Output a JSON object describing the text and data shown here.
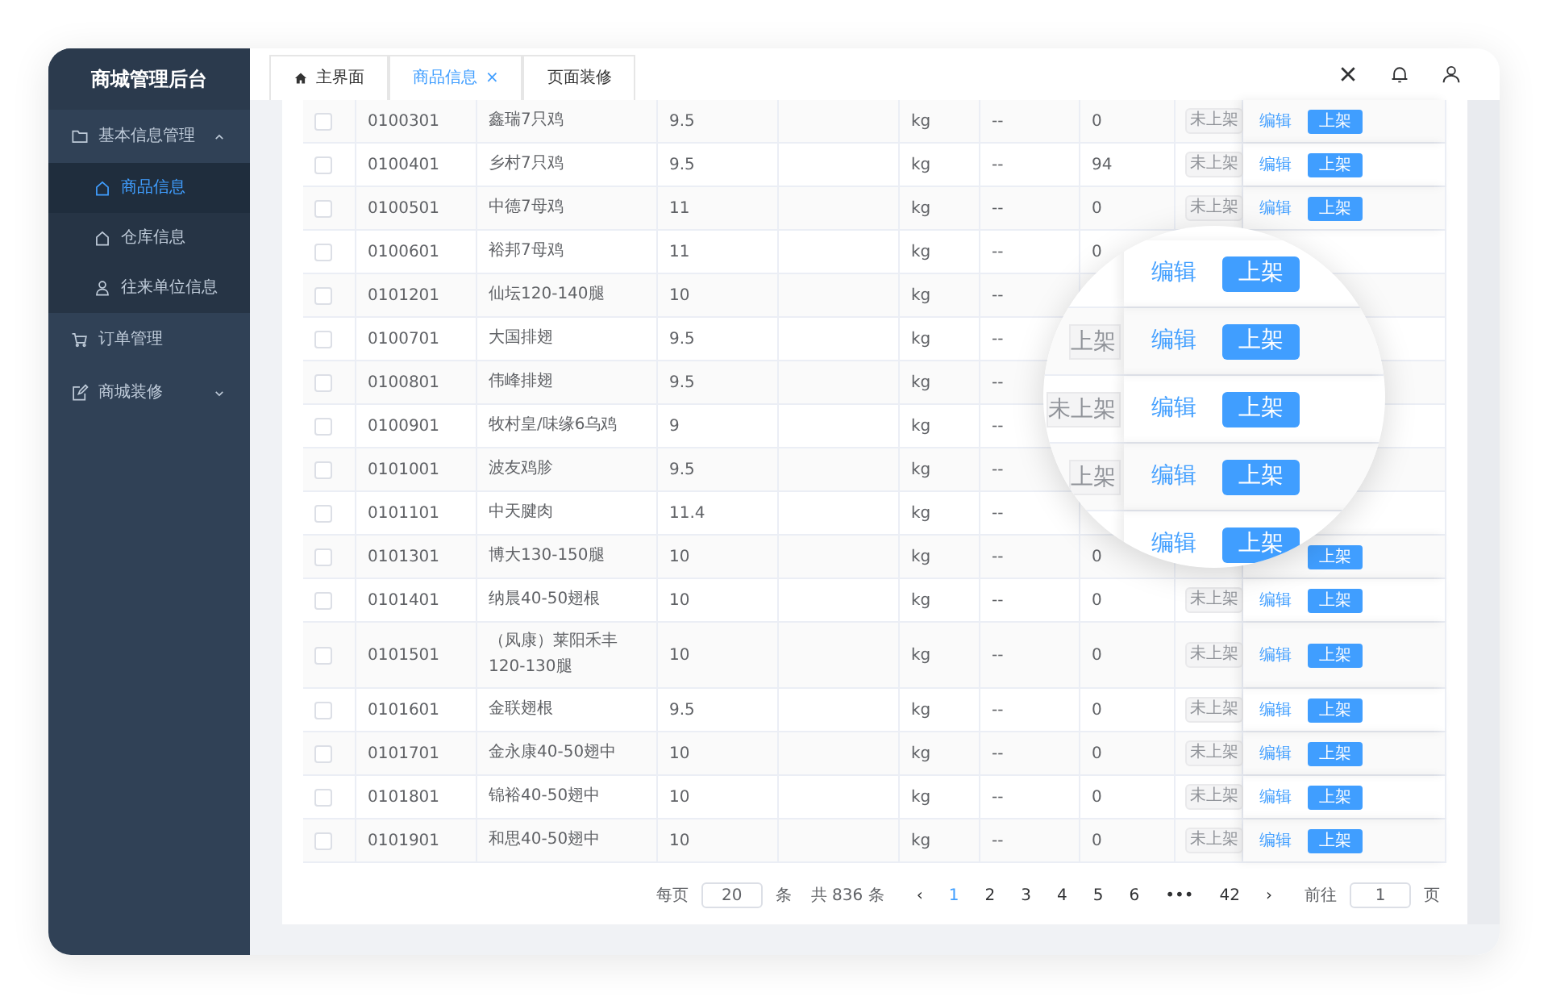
{
  "sidebar": {
    "title": "商城管理后台",
    "items": [
      {
        "label": "基本信息管理",
        "expanded": true,
        "children": [
          {
            "label": "商品信息",
            "selected": true
          },
          {
            "label": "仓库信息",
            "selected": false
          },
          {
            "label": "往来单位信息",
            "selected": false
          }
        ]
      },
      {
        "label": "订单管理"
      },
      {
        "label": "商城装修",
        "expanded": false
      }
    ]
  },
  "tabs": [
    {
      "label": "主界面",
      "selected": false
    },
    {
      "label": "商品信息",
      "selected": true,
      "close": "×"
    },
    {
      "label": "页面装修",
      "selected": false
    }
  ],
  "table": {
    "rows": [
      {
        "checked": false,
        "code": "0100301",
        "name": "鑫瑞7只鸡",
        "price": "9.5",
        "unit": "kg",
        "dash": "--",
        "qty": "0",
        "status": "未上架",
        "edit": "编辑",
        "publish": "上架"
      },
      {
        "checked": false,
        "code": "0100401",
        "name": "乡村7只鸡",
        "price": "9.5",
        "unit": "kg",
        "dash": "--",
        "qty": "94",
        "status": "未上架",
        "edit": "编辑",
        "publish": "上架"
      },
      {
        "checked": false,
        "code": "0100501",
        "name": "中德7母鸡",
        "price": "11",
        "unit": "kg",
        "dash": "--",
        "qty": "0",
        "status": "未上架",
        "edit": "编辑",
        "publish": "上架"
      },
      {
        "checked": false,
        "code": "0100601",
        "name": "裕邦7母鸡",
        "price": "11",
        "unit": "kg",
        "dash": "--",
        "qty": "0"
      },
      {
        "checked": false,
        "code": "0101201",
        "name": "仙坛120-140腿",
        "price": "10",
        "unit": "kg",
        "dash": "--"
      },
      {
        "checked": false,
        "code": "0100701",
        "name": "大国排翅",
        "price": "9.5",
        "unit": "kg",
        "dash": "--"
      },
      {
        "checked": false,
        "code": "0100801",
        "name": "伟峰排翅",
        "price": "9.5",
        "unit": "kg",
        "dash": "--"
      },
      {
        "checked": false,
        "code": "0100901",
        "name": "牧村皇/味缘6乌鸡",
        "price": "9",
        "unit": "kg",
        "dash": "--"
      },
      {
        "checked": false,
        "code": "0101001",
        "name": "波友鸡胗",
        "price": "9.5",
        "unit": "kg",
        "dash": "--"
      },
      {
        "checked": false,
        "code": "0101101",
        "name": "中天腱肉",
        "price": "11.4",
        "unit": "kg",
        "dash": "--"
      },
      {
        "checked": false,
        "code": "0101301",
        "name": "博大130-150腿",
        "price": "10",
        "unit": "kg",
        "dash": "--",
        "qty": "0",
        "publish": "上架"
      },
      {
        "checked": false,
        "code": "0101401",
        "name": "纳晨40-50翅根",
        "price": "10",
        "unit": "kg",
        "dash": "--",
        "qty": "0",
        "status": "未上架",
        "edit": "编辑",
        "publish": "上架"
      },
      {
        "checked": false,
        "code": "0101501",
        "name": "（凤康）莱阳禾丰120-130腿",
        "price": "10",
        "unit": "kg",
        "dash": "--",
        "qty": "0",
        "status": "未上架",
        "edit": "编辑",
        "publish": "上架"
      },
      {
        "checked": false,
        "code": "0101601",
        "name": "金联翅根",
        "price": "9.5",
        "unit": "kg",
        "dash": "--",
        "qty": "0",
        "status": "未上架",
        "edit": "编辑",
        "publish": "上架"
      },
      {
        "checked": false,
        "code": "0101701",
        "name": "金永康40-50翅中",
        "price": "10",
        "unit": "kg",
        "dash": "--",
        "qty": "0",
        "status": "未上架",
        "edit": "编辑",
        "publish": "上架"
      },
      {
        "checked": false,
        "code": "0101801",
        "name": "锦裕40-50翅中",
        "price": "10",
        "unit": "kg",
        "dash": "--",
        "qty": "0",
        "status": "未上架",
        "edit": "编辑",
        "publish": "上架"
      },
      {
        "checked": false,
        "code": "0101901",
        "name": "和思40-50翅中",
        "price": "10",
        "unit": "kg",
        "dash": "--",
        "qty": "0",
        "status": "未上架",
        "edit": "编辑",
        "publish": "上架"
      }
    ]
  },
  "magnifier": {
    "rows": [
      {
        "edit": "编辑",
        "publish": "上架"
      },
      {
        "status": "上架",
        "edit": "编辑",
        "publish": "上架"
      },
      {
        "status": "未上架",
        "edit": "编辑",
        "publish": "上架"
      },
      {
        "status": "上架",
        "edit": "编辑",
        "publish": "上架"
      },
      {
        "edit": "编辑",
        "publish": "上架"
      }
    ]
  },
  "pagination": {
    "per_page_label": "每页",
    "per_page": "20",
    "per_page_unit": "条",
    "total": "共 836 条",
    "prev": "‹",
    "pages": [
      {
        "label": "1",
        "selected": true
      },
      {
        "label": "2",
        "selected": false
      },
      {
        "label": "3",
        "selected": false
      },
      {
        "label": "4",
        "selected": false
      },
      {
        "label": "5",
        "selected": false
      },
      {
        "label": "6",
        "selected": false
      },
      {
        "label": "•••",
        "selected": false
      },
      {
        "label": "42",
        "selected": false
      }
    ],
    "next": "›",
    "goto_label": "前往",
    "goto": "1",
    "goto_unit": "页"
  }
}
